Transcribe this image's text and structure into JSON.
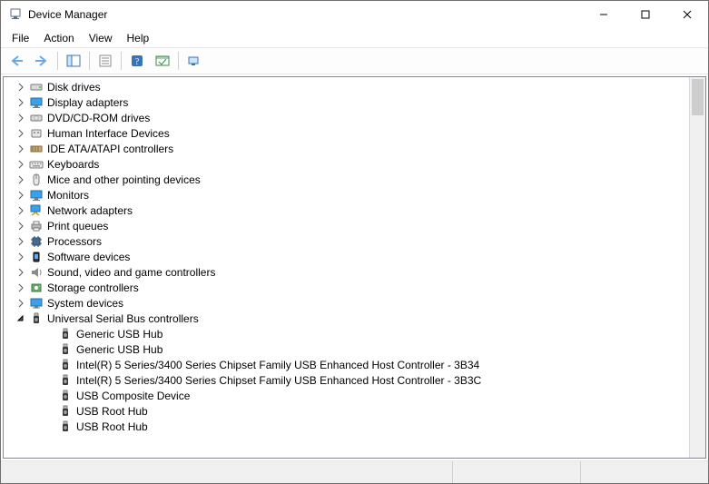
{
  "window": {
    "title": "Device Manager"
  },
  "menu": {
    "file": "File",
    "action": "Action",
    "view": "View",
    "help": "Help"
  },
  "tree": {
    "nodes": [
      {
        "label": "Disk drives",
        "expanded": false,
        "icon": "disk"
      },
      {
        "label": "Display adapters",
        "expanded": false,
        "icon": "display"
      },
      {
        "label": "DVD/CD-ROM drives",
        "expanded": false,
        "icon": "dvd"
      },
      {
        "label": "Human Interface Devices",
        "expanded": false,
        "icon": "hid"
      },
      {
        "label": "IDE ATA/ATAPI controllers",
        "expanded": false,
        "icon": "ide"
      },
      {
        "label": "Keyboards",
        "expanded": false,
        "icon": "keyboard"
      },
      {
        "label": "Mice and other pointing devices",
        "expanded": false,
        "icon": "mouse"
      },
      {
        "label": "Monitors",
        "expanded": false,
        "icon": "monitor"
      },
      {
        "label": "Network adapters",
        "expanded": false,
        "icon": "network"
      },
      {
        "label": "Print queues",
        "expanded": false,
        "icon": "printer"
      },
      {
        "label": "Processors",
        "expanded": false,
        "icon": "processor"
      },
      {
        "label": "Software devices",
        "expanded": false,
        "icon": "software"
      },
      {
        "label": "Sound, video and game controllers",
        "expanded": false,
        "icon": "sound"
      },
      {
        "label": "Storage controllers",
        "expanded": false,
        "icon": "storage"
      },
      {
        "label": "System devices",
        "expanded": false,
        "icon": "system"
      },
      {
        "label": "Universal Serial Bus controllers",
        "expanded": true,
        "icon": "usb",
        "children": [
          {
            "label": "Generic USB Hub",
            "icon": "usb"
          },
          {
            "label": "Generic USB Hub",
            "icon": "usb"
          },
          {
            "label": "Intel(R) 5 Series/3400 Series Chipset Family USB Enhanced Host Controller - 3B34",
            "icon": "usb"
          },
          {
            "label": "Intel(R) 5 Series/3400 Series Chipset Family USB Enhanced Host Controller - 3B3C",
            "icon": "usb"
          },
          {
            "label": "USB Composite Device",
            "icon": "usb"
          },
          {
            "label": "USB Root Hub",
            "icon": "usb"
          },
          {
            "label": "USB Root Hub",
            "icon": "usb"
          }
        ]
      }
    ]
  }
}
